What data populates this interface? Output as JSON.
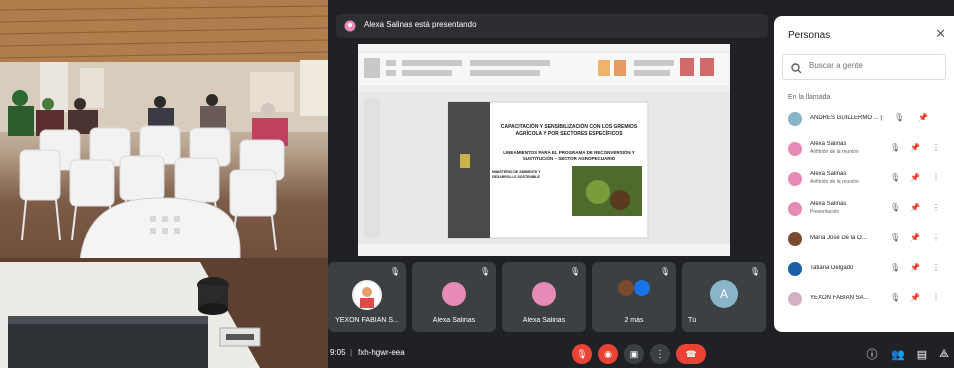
{
  "meet": {
    "presenting_text": "Alexa Salinas está presentando",
    "slide": {
      "title": "CAPACITACIÓN Y SENSIBILIZACIÓN CON LOS GREMIOS AGRÍCOLA Y POR SECTORES ESPECÍFICOS",
      "subtitle": "LINEAMIENTOS PARA EL PROGRAMA DE RECONVERSIÓN Y SUSTITUCIÓN – SECTOR AGROPECUARIO",
      "ministry": "MINISTERIO DE AMBIENTE Y DESARROLLO SOSTENIBLE"
    },
    "tiles": [
      {
        "name": "YEXON FABIAN S..."
      },
      {
        "name": "Alexa Salinas"
      },
      {
        "name": "Alexa Salinas"
      },
      {
        "name": "2 más"
      },
      {
        "name": "Tú",
        "initial": "A"
      }
    ],
    "bottom": {
      "time": "9:05",
      "code": "fxh-hgwr-eea"
    }
  },
  "people_panel": {
    "title": "Personas",
    "search_placeholder": "Buscar a gente",
    "section": "En la llamada",
    "people": [
      {
        "name": "ANDRES GUILLERMO ... (Tú)",
        "sub": "",
        "color": "#8ab4c8"
      },
      {
        "name": "Alexa Salinas",
        "sub": "Anfitrión de la reunión",
        "color": "#e58bb5"
      },
      {
        "name": "Alexa Salinas",
        "sub": "Anfitrión de la reunión",
        "color": "#e58bb5"
      },
      {
        "name": "Alexa Salinas",
        "sub": "Presentación",
        "color": "#e58bb5"
      },
      {
        "name": "María José De la O...",
        "sub": "",
        "color": "#7a4a2e"
      },
      {
        "name": "Tatiana Delgado",
        "sub": "",
        "color": "#1a5fa8"
      },
      {
        "name": "YEXON FABIAN SA...",
        "sub": "",
        "color": "#d3b1c4"
      }
    ]
  }
}
